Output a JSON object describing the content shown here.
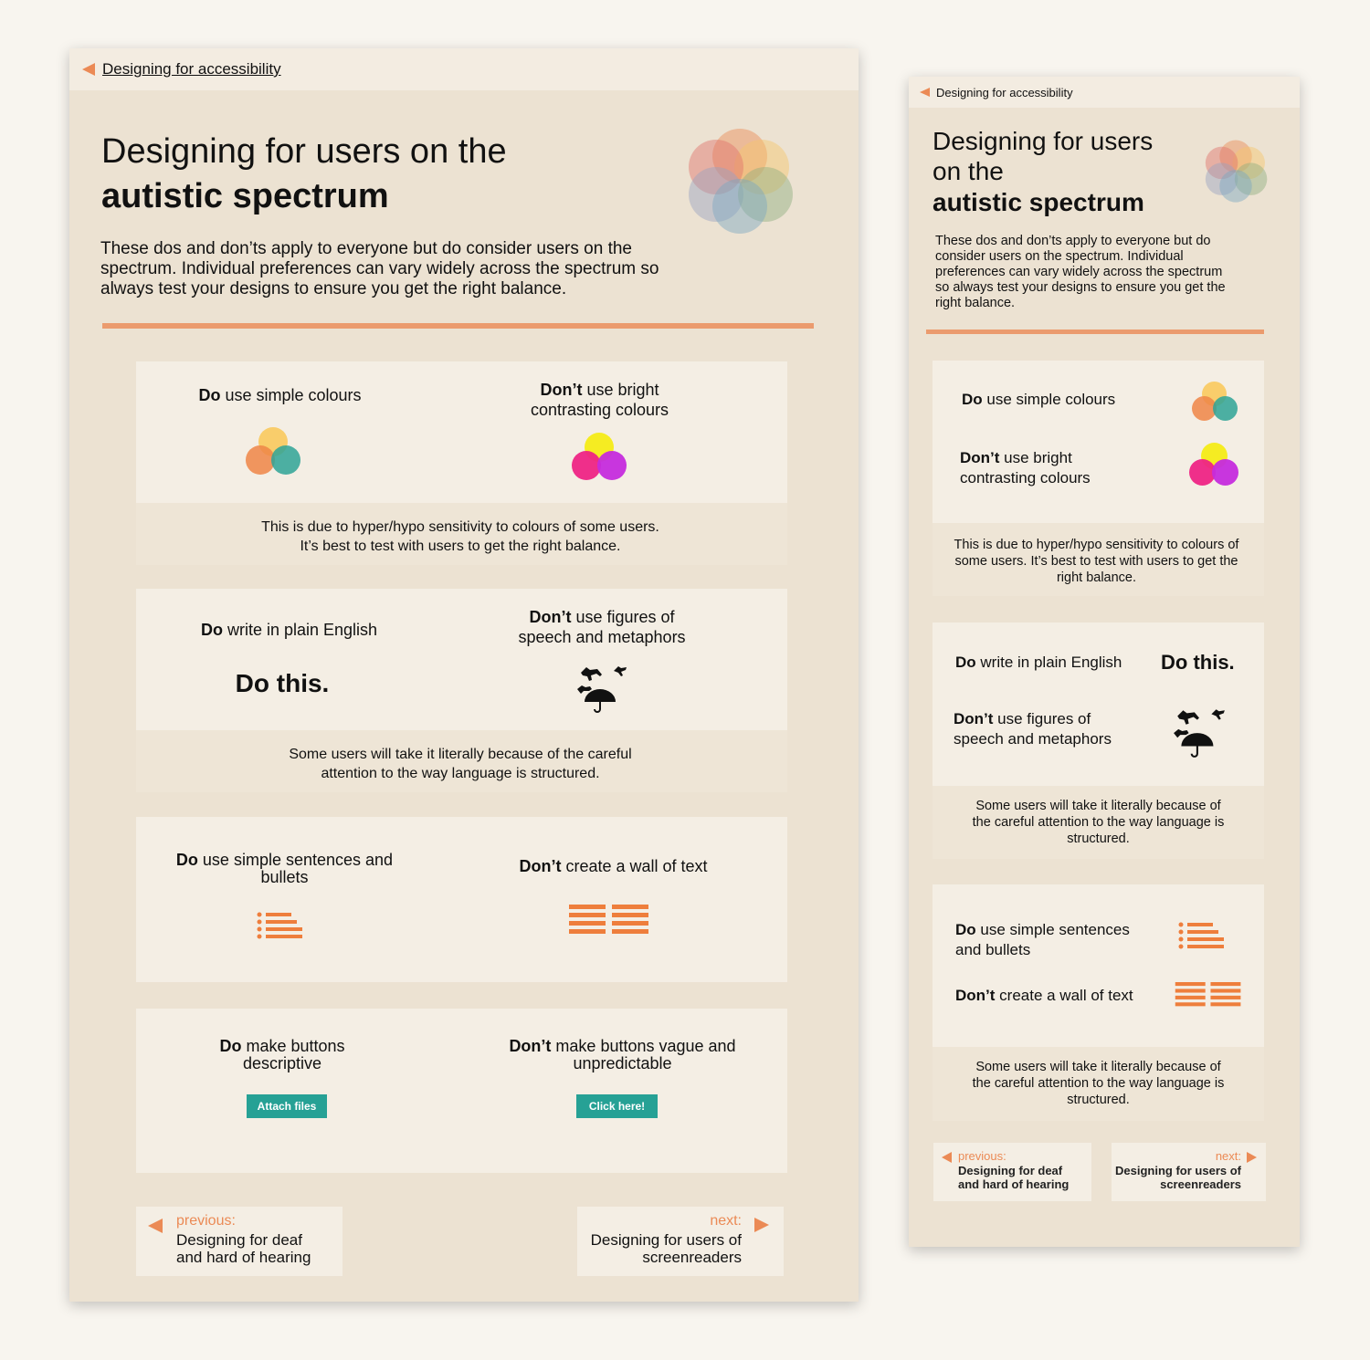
{
  "colors": {
    "accent": "#eb8a55",
    "panel_bg": "#ece2d2",
    "button_teal": "#26a195"
  },
  "breadcrumb": {
    "label": "Designing for accessibility",
    "icon": "back-arrow-icon"
  },
  "header": {
    "title_line1": "Designing for users on the",
    "title_line1_mobile_a": "Designing for users",
    "title_line1_mobile_b": "on the",
    "title_line2": "autistic spectrum",
    "intro": "These dos and don’ts apply to everyone but do consider users on the spectrum. Individual preferences can vary widely across the spectrum so always test your designs to ensure you get the right balance."
  },
  "cards": [
    {
      "do_bold": "Do",
      "do_text": " use simple colours",
      "dont_bold": "Don’t",
      "dont_text": " use bright contrasting colours",
      "note": "This is due to hyper/hypo sensitivity to colours of some users. It’s best to test with users to get the right balance."
    },
    {
      "do_bold": "Do",
      "do_text": " write in plain English",
      "do_example": "Do this.",
      "dont_bold": "Don’t",
      "dont_text": " use figures of speech and metaphors",
      "note": "Some users will take it literally because of the careful attention to the way language is structured."
    },
    {
      "do_bold": "Do",
      "do_text": " use simple sentences and bullets",
      "dont_bold": "Don’t",
      "dont_text": " create a wall of text",
      "note": "Some users will take it literally because of the careful attention to the way language is structured."
    },
    {
      "do_bold": "Do",
      "do_text": " make buttons descriptive",
      "do_button": "Attach files",
      "dont_bold": "Don’t",
      "dont_text": " make buttons vague and unpredictable",
      "dont_button": "Click here!"
    }
  ],
  "nav": {
    "previous_label": "previous:",
    "previous_title": "Designing for deaf and hard of hearing",
    "next_label": "next:",
    "next_title": "Designing for users of screenreaders"
  }
}
